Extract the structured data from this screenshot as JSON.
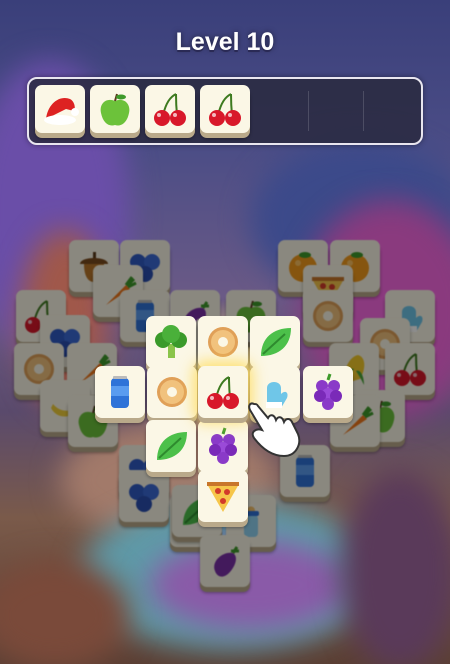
{
  "level": {
    "label": "Level 10"
  },
  "tray": {
    "capacity": 7,
    "items": [
      {
        "icon": "santa-hat-icon"
      },
      {
        "icon": "green-apple-icon"
      },
      {
        "icon": "cherry-icon"
      },
      {
        "icon": "cherry-icon"
      }
    ]
  },
  "board": {
    "tiles": [
      {
        "icon": "acorn-icon",
        "active": false
      },
      {
        "icon": "blueberry-icon",
        "active": false
      },
      {
        "icon": "orange-icon",
        "active": false
      },
      {
        "icon": "orange-icon",
        "active": false
      },
      {
        "icon": "carrot-icon",
        "active": false
      },
      {
        "icon": "pizza-slice-icon",
        "active": false
      },
      {
        "icon": "cherry-icon",
        "active": false
      },
      {
        "icon": "blueberry-icon",
        "active": false
      },
      {
        "icon": "soda-can-icon",
        "active": false
      },
      {
        "icon": "eggplant-icon",
        "active": false
      },
      {
        "icon": "green-apple-icon",
        "active": false
      },
      {
        "icon": "donut-icon",
        "active": false
      },
      {
        "icon": "mitten-icon",
        "active": false
      },
      {
        "icon": "donut-icon",
        "active": false
      },
      {
        "icon": "carrot-icon",
        "active": false
      },
      {
        "icon": "donut-icon",
        "active": false
      },
      {
        "icon": "donut-icon",
        "active": false
      },
      {
        "icon": "corn-icon",
        "active": false
      },
      {
        "icon": "cherry-icon",
        "active": false
      },
      {
        "icon": "banana-icon",
        "active": false
      },
      {
        "icon": "green-apple-icon",
        "active": false
      },
      {
        "icon": "green-apple-icon",
        "active": false
      },
      {
        "icon": "blueberry-icon",
        "active": false
      },
      {
        "icon": "carrot-icon",
        "active": false
      },
      {
        "icon": "blueberry-icon",
        "active": false
      },
      {
        "icon": "soda-can-icon",
        "active": false
      },
      {
        "icon": "leaf-icon",
        "active": false
      },
      {
        "icon": "leaf-icon",
        "active": false
      },
      {
        "icon": "baby-bottle-icon",
        "active": false
      },
      {
        "icon": "eggplant-icon",
        "active": false
      },
      {
        "icon": "broccoli-icon",
        "active": true
      },
      {
        "icon": "donut-icon",
        "active": true
      },
      {
        "icon": "leaf-icon",
        "active": true
      },
      {
        "icon": "soda-can-icon",
        "active": true
      },
      {
        "icon": "donut-icon",
        "active": true
      },
      {
        "icon": "mitten-icon",
        "active": true
      },
      {
        "icon": "grapes-icon",
        "active": true
      },
      {
        "icon": "leaf-icon",
        "active": true
      },
      {
        "icon": "grapes-icon",
        "active": true
      },
      {
        "icon": "pizza-slice-icon",
        "active": true
      },
      {
        "icon": "cherry-icon",
        "active": true,
        "highlighted": true
      }
    ]
  },
  "hint": {
    "icon": "pointing-hand-icon"
  }
}
